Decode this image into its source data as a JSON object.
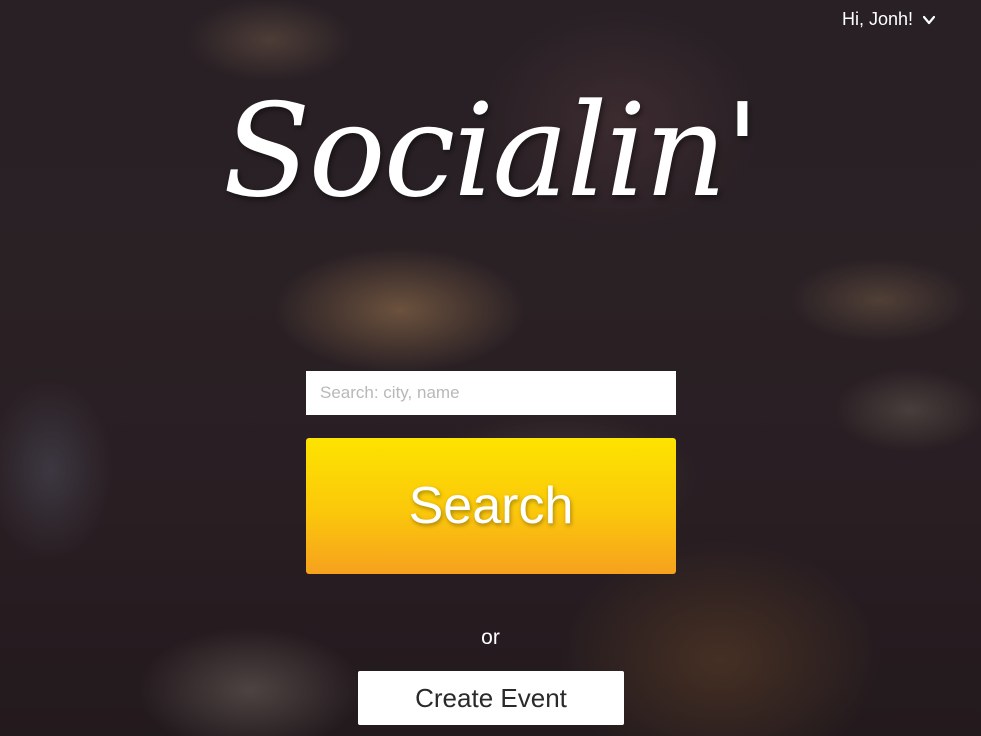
{
  "header": {
    "greeting": "Hi, Jonh!",
    "menu_icon": "chevron-down-icon"
  },
  "hero": {
    "logo_text": "Socialin'"
  },
  "search": {
    "placeholder": "Search: city, name",
    "value": "",
    "button_label": "Search"
  },
  "divider": {
    "or_label": "or"
  },
  "actions": {
    "create_event_label": "Create Event"
  },
  "colors": {
    "search_button_top": "#fde400",
    "search_button_bottom": "#f6a11e",
    "text_light": "#ffffff",
    "create_button_bg": "#ffffff"
  }
}
